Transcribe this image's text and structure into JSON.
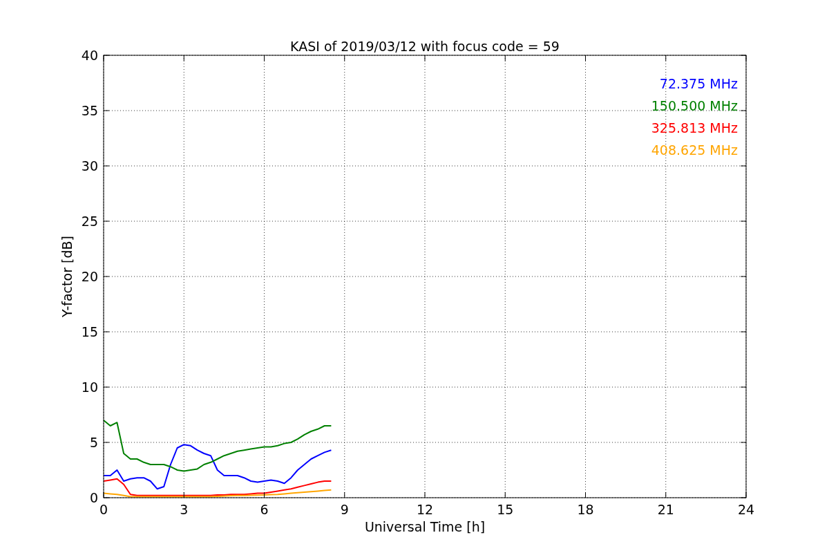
{
  "chart_data": {
    "type": "line",
    "title": "KASI of 2019/03/12 with focus code = 59",
    "xlabel": "Universal Time [h]",
    "ylabel": "Y-factor [dB]",
    "x": [
      0,
      0.25,
      0.5,
      0.75,
      1,
      1.25,
      1.5,
      1.75,
      2,
      2.25,
      2.5,
      2.75,
      3,
      3.25,
      3.5,
      3.75,
      4,
      4.25,
      4.5,
      4.75,
      5,
      5.25,
      5.5,
      5.75,
      6,
      6.25,
      6.5,
      6.75,
      7,
      7.25,
      7.5,
      7.75,
      8,
      8.25,
      8.5
    ],
    "series": [
      {
        "name": "72.375 MHz",
        "color": "#0000ff",
        "values": [
          2,
          2,
          2.5,
          1.5,
          1.7,
          1.8,
          1.8,
          1.5,
          0.8,
          1,
          3,
          4.5,
          4.8,
          4.7,
          4.3,
          4,
          3.8,
          2.5,
          2,
          2,
          2,
          1.8,
          1.5,
          1.4,
          1.5,
          1.6,
          1.5,
          1.3,
          1.8,
          2.5,
          3,
          3.5,
          3.8,
          4.1,
          4.3
        ]
      },
      {
        "name": "150.500 MHz",
        "color": "#008000",
        "values": [
          7,
          6.5,
          6.8,
          4,
          3.5,
          3.5,
          3.2,
          3,
          3,
          3,
          2.8,
          2.5,
          2.4,
          2.5,
          2.6,
          3,
          3.2,
          3.5,
          3.8,
          4,
          4.2,
          4.3,
          4.4,
          4.5,
          4.6,
          4.6,
          4.7,
          4.9,
          5,
          5.3,
          5.7,
          6,
          6.2,
          6.5,
          6.5
        ]
      },
      {
        "name": "325.813 MHz",
        "color": "#ff0000",
        "values": [
          1.5,
          1.6,
          1.7,
          1.2,
          0.3,
          0.2,
          0.2,
          0.2,
          0.2,
          0.2,
          0.2,
          0.2,
          0.2,
          0.2,
          0.2,
          0.2,
          0.2,
          0.25,
          0.25,
          0.3,
          0.3,
          0.3,
          0.35,
          0.4,
          0.4,
          0.5,
          0.6,
          0.7,
          0.8,
          0.95,
          1.1,
          1.25,
          1.4,
          1.5,
          1.5
        ]
      },
      {
        "name": "408.625 MHz",
        "color": "#ffa500",
        "values": [
          0.4,
          0.35,
          0.3,
          0.2,
          0.1,
          0.1,
          0.1,
          0.1,
          0.1,
          0.1,
          0.1,
          0.1,
          0.1,
          0.1,
          0.1,
          0.1,
          0.1,
          0.12,
          0.15,
          0.18,
          0.2,
          0.2,
          0.22,
          0.24,
          0.25,
          0.28,
          0.3,
          0.35,
          0.4,
          0.45,
          0.5,
          0.55,
          0.6,
          0.65,
          0.7
        ]
      }
    ],
    "grid": true,
    "xlim": [
      0,
      24
    ],
    "ylim": [
      0,
      40
    ],
    "xticks": [
      0,
      3,
      6,
      9,
      12,
      15,
      18,
      21,
      24
    ],
    "yticks": [
      0,
      5,
      10,
      15,
      20,
      25,
      30,
      35,
      40
    ]
  }
}
